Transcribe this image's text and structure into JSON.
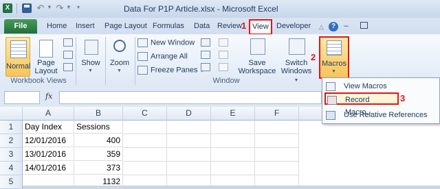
{
  "window": {
    "title": "Data For P1P Article.xlsx - Microsoft Excel"
  },
  "tabs": [
    "File",
    "Home",
    "Insert",
    "Page Layout",
    "Formulas",
    "Data",
    "Review",
    "View",
    "Developer"
  ],
  "annotations": {
    "a1": "1",
    "a2": "2",
    "a3": "3"
  },
  "ribbon": {
    "workbook_views": {
      "label": "Workbook Views",
      "normal": "Normal",
      "page_layout_1": "Page",
      "page_layout_2": "Layout"
    },
    "show": "Show",
    "zoom": "Zoom",
    "window": {
      "label": "Window",
      "new_window": "New Window",
      "arrange_all": "Arrange All",
      "freeze_panes": "Freeze Panes",
      "save_workspace_1": "Save",
      "save_workspace_2": "Workspace",
      "switch_windows_1": "Switch",
      "switch_windows_2": "Windows"
    },
    "macros": "Macros"
  },
  "formula_bar": {
    "fx": "fx",
    "value": ""
  },
  "macro_menu": {
    "view_macros": "View Macros",
    "record_macro": "Record Macro...",
    "use_relative": "Use Relative References"
  },
  "sheet": {
    "columns": [
      "A",
      "B",
      "C",
      "D",
      "E",
      "F"
    ],
    "rows": [
      {
        "num": "1",
        "a": "Day Index",
        "b": "Sessions"
      },
      {
        "num": "2",
        "a": "12/01/2016",
        "b": "400"
      },
      {
        "num": "3",
        "a": "13/01/2016",
        "b": "359"
      },
      {
        "num": "4",
        "a": "14/01/2016",
        "b": "373"
      },
      {
        "num": "5",
        "a": "",
        "b": "1132"
      }
    ]
  },
  "colors": {
    "accent_red": "#e01515",
    "excel_green": "#1f7138",
    "highlight": "#f8c45b"
  }
}
